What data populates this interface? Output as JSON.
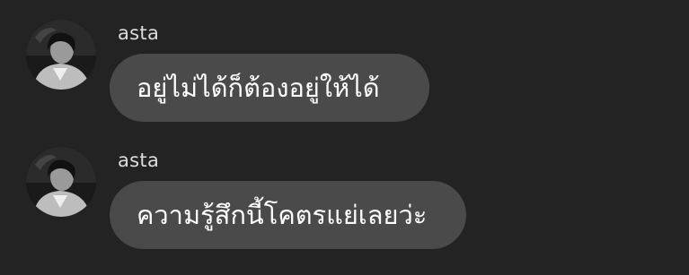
{
  "messages": [
    {
      "sender": "asta",
      "text": "อยู่ไม่ได้ก็ต้องอยู่ให้ได้",
      "avatar_icon": "user-avatar-photo"
    },
    {
      "sender": "asta",
      "text": "ความรู้สึกนี้โคตรแย่เลยว่ะ",
      "avatar_icon": "user-avatar-photo"
    }
  ],
  "colors": {
    "background": "#232323",
    "bubble": "#4a4a4a",
    "text": "#ffffff",
    "sender": "#dcdcdc"
  }
}
